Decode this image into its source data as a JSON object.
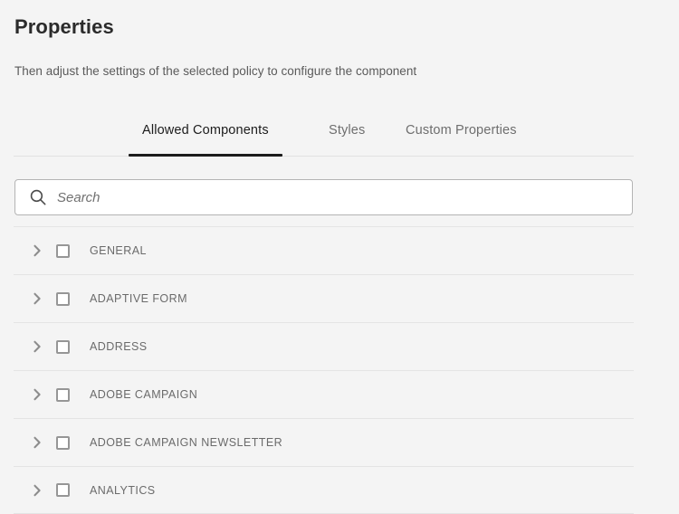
{
  "header": {
    "title": "Properties",
    "subtitle": "Then adjust the settings of the selected policy to configure the component"
  },
  "tabs": [
    {
      "label": "Allowed Components",
      "active": true
    },
    {
      "label": "Styles",
      "active": false
    },
    {
      "label": "Custom Properties",
      "active": false
    }
  ],
  "search": {
    "placeholder": "Search",
    "value": "",
    "icon": "search-icon"
  },
  "component_groups": [
    {
      "label": "GENERAL",
      "checked": false,
      "expanded": false
    },
    {
      "label": "ADAPTIVE FORM",
      "checked": false,
      "expanded": false
    },
    {
      "label": "ADDRESS",
      "checked": false,
      "expanded": false
    },
    {
      "label": "ADOBE CAMPAIGN",
      "checked": false,
      "expanded": false
    },
    {
      "label": "ADOBE CAMPAIGN NEWSLETTER",
      "checked": false,
      "expanded": false
    },
    {
      "label": "ANALYTICS",
      "checked": false,
      "expanded": false
    }
  ],
  "icons": {
    "chevron": "chevron-right-icon",
    "checkbox": "checkbox-unchecked-icon"
  },
  "colors": {
    "background": "#f4f4f4",
    "active_tab_underline": "#1c1c1c",
    "divider": "#e4e4e4",
    "label_text": "#6b6b6b",
    "input_border": "#b4b4b4"
  }
}
